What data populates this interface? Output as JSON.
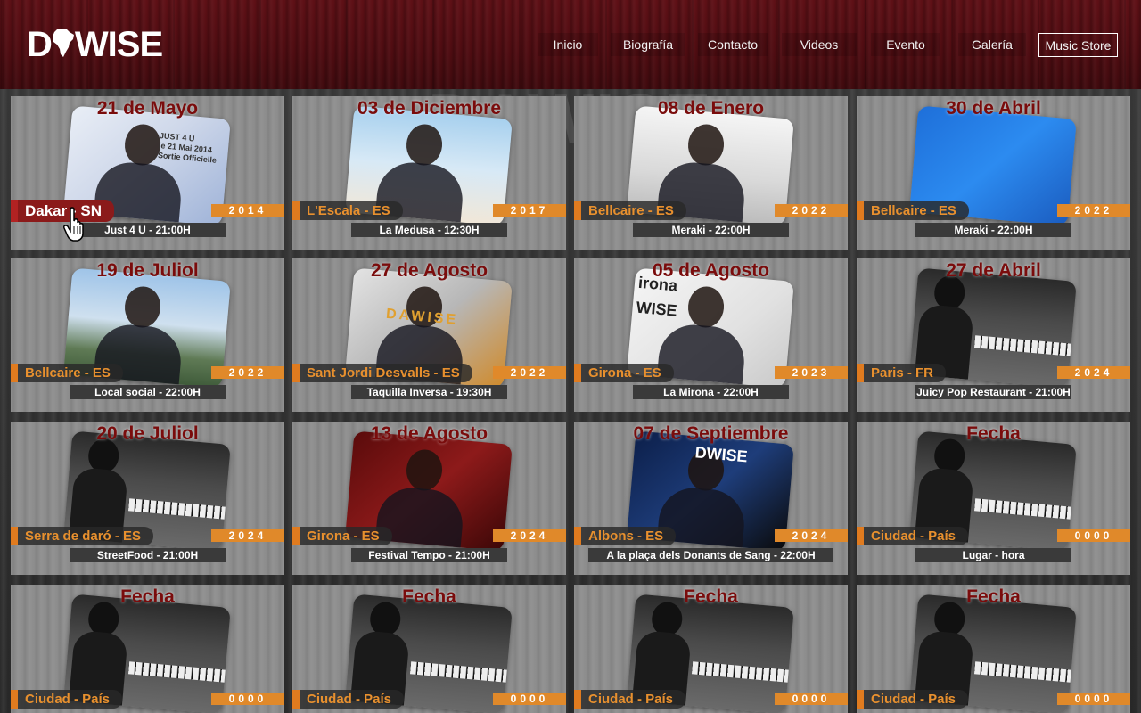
{
  "header": {
    "logo_left": "D",
    "logo_right": "WISE",
    "nav": [
      "Inicio",
      "Biografía",
      "Contacto",
      "Videos",
      "Evento",
      "Galería",
      "Music Store"
    ]
  },
  "watermark": "DAWISE",
  "colors": {
    "header_bg": "#4e0c11",
    "date_text": "#7a0c0c",
    "place_text": "#e8902e",
    "accent_orange": "#e07b1f",
    "active_place_bg": "#8b1a1a"
  },
  "events": [
    {
      "date": "21 de Mayo",
      "place": "Dakar - SN",
      "year": "2014",
      "venue": "Just 4 U - 21:00H",
      "photo": "poster-icon",
      "poster_text": "JUST 4 U\nle 21 Mai 2014\nSortie Officielle",
      "active": true
    },
    {
      "date": "03 de Diciembre",
      "place": "L'Escala - ES",
      "year": "2017",
      "venue": "La Medusa - 12:30H",
      "photo": "beach-portrait-icon"
    },
    {
      "date": "08 de Enero",
      "place": "Bellcaire - ES",
      "year": "2022",
      "venue": "Meraki - 22:00H",
      "photo": "bw-portrait-icon"
    },
    {
      "date": "30 de Abril",
      "place": "Bellcaire - ES",
      "year": "2022",
      "venue": "Meraki - 22:00H",
      "photo": "blue-shadow-icon"
    },
    {
      "date": "19 de Juliol",
      "place": "Bellcaire - ES",
      "year": "2022",
      "venue": "Local social - 22:00H",
      "photo": "park-portrait-icon"
    },
    {
      "date": "27 de Agosto",
      "place": "Sant Jordi Desvalls - ES",
      "year": "2022",
      "venue": "Taquilla Inversa - 19:30H",
      "photo": "live-poster-icon",
      "poster_text": "DAWISE"
    },
    {
      "date": "05 de Agosto",
      "place": "Girona - ES",
      "year": "2023",
      "venue": "La Mirona - 22:00H",
      "photo": "mirona-poster-icon",
      "poster_text": "irona\nWISE"
    },
    {
      "date": "27 de Abril",
      "place": "Paris - FR",
      "year": "2024",
      "venue": "Juicy Pop Restaurant - 21:00H",
      "photo": "piano-icon"
    },
    {
      "date": "20 de Juliol",
      "place": "Serra de daró - ES",
      "year": "2024",
      "venue": "StreetFood - 21:00H",
      "photo": "piano-icon"
    },
    {
      "date": "13 de Agosto",
      "place": "Girona - ES",
      "year": "2024",
      "venue": "Festival Tempo - 21:00H",
      "photo": "stage-icon"
    },
    {
      "date": "07 de Septiembre",
      "place": "Albons - ES",
      "year": "2024",
      "venue": "A la plaça dels Donants de Sang - 22:00H",
      "photo": "guitar-poster-icon",
      "poster_text": "DWISE"
    },
    {
      "date": "Fecha",
      "place": "Ciudad - País",
      "year": "0000",
      "venue": "Lugar - hora",
      "photo": "piano-icon"
    },
    {
      "date": "Fecha",
      "place": "Ciudad - País",
      "year": "0000",
      "venue": "",
      "photo": "piano-icon"
    },
    {
      "date": "Fecha",
      "place": "Ciudad - País",
      "year": "0000",
      "venue": "",
      "photo": "piano-icon"
    },
    {
      "date": "Fecha",
      "place": "Ciudad - País",
      "year": "0000",
      "venue": "",
      "photo": "piano-icon"
    },
    {
      "date": "Fecha",
      "place": "Ciudad - País",
      "year": "0000",
      "venue": "",
      "photo": "piano-icon"
    }
  ]
}
